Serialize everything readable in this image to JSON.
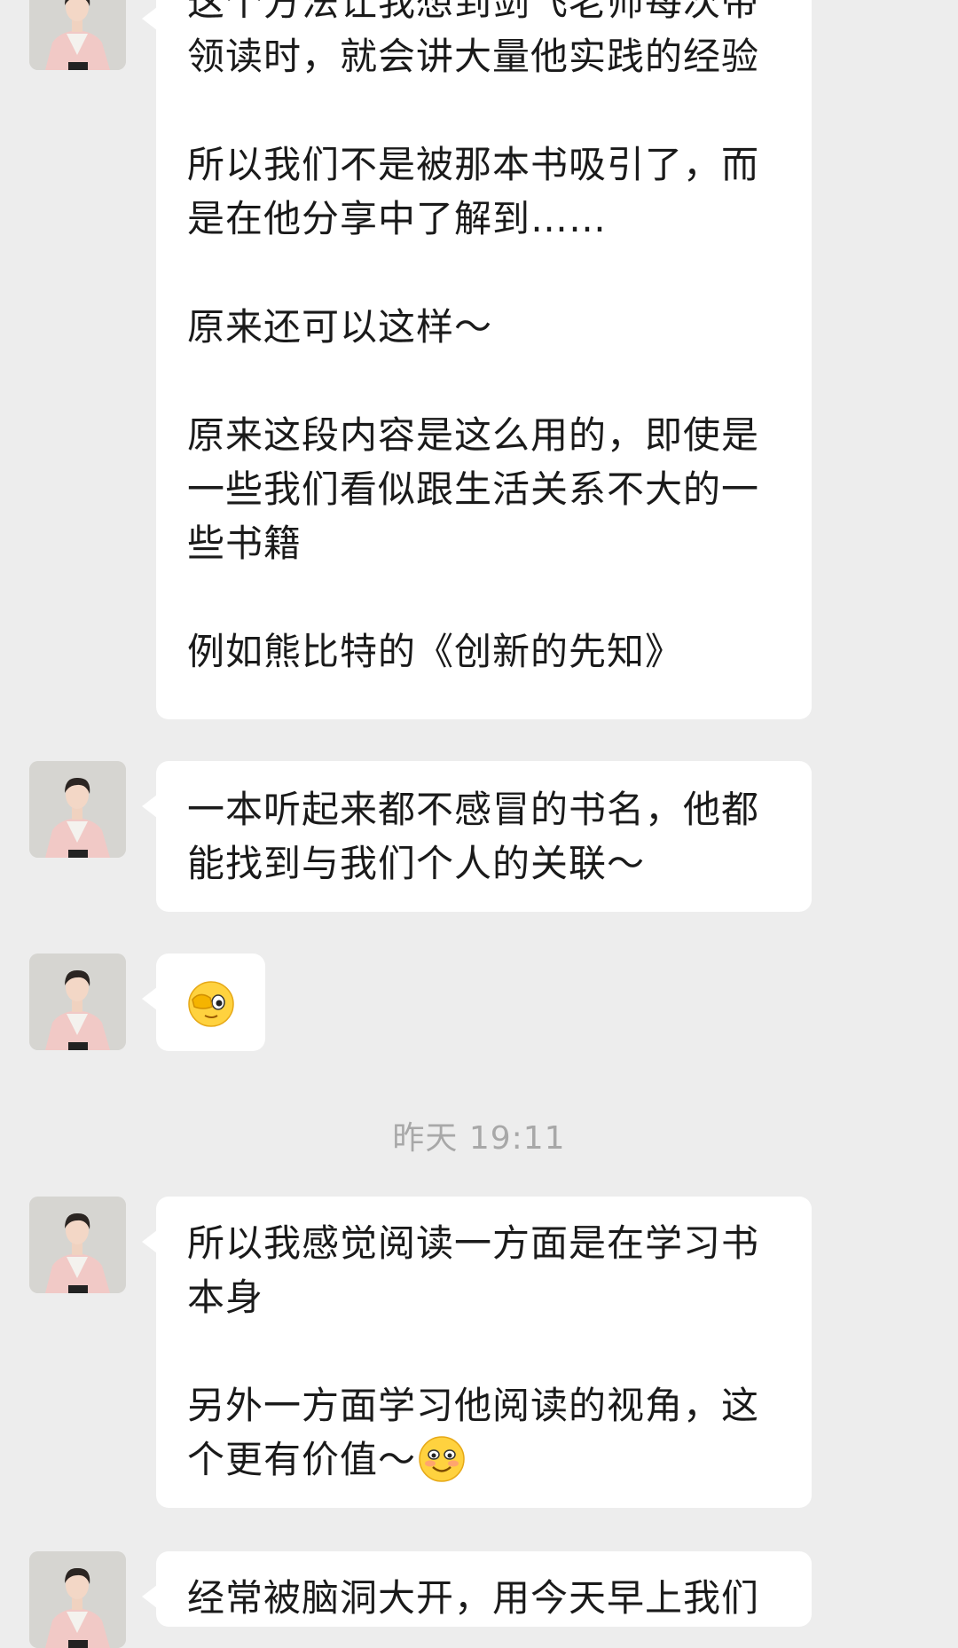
{
  "messages": [
    {
      "lines": [
        "这个方法让我想到剑飞老师每次带",
        "领读时，就会讲大量他实践的经验",
        "",
        "所以我们不是被那本书吸引了，而",
        "是在他分享中了解到……",
        "",
        "原来还可以这样～",
        "",
        "原来这段内容是这么用的，即使是",
        "一些我们看似跟生活关系不大的一",
        "些书籍",
        "",
        "例如熊比特的《创新的先知》"
      ]
    },
    {
      "lines": [
        "一本听起来都不感冒的书名，他都",
        "能找到与我们个人的关联～"
      ]
    },
    {
      "emoji": "facepalm-peek-emoji"
    },
    {
      "lines": [
        "所以我感觉阅读一方面是在学习书",
        "本身",
        "",
        "另外一方面学习他阅读的视角，这",
        "个更有价值～"
      ],
      "trailing_emoji": "blushing-smile-emoji"
    },
    {
      "lines": [
        "经常被脑洞大开，用今天早上我们"
      ]
    }
  ],
  "timestamp": "昨天 19:11",
  "colors": {
    "background": "#ededed",
    "bubble": "#ffffff",
    "text": "#1a1a1a",
    "timestamp": "#a8a8a8"
  }
}
